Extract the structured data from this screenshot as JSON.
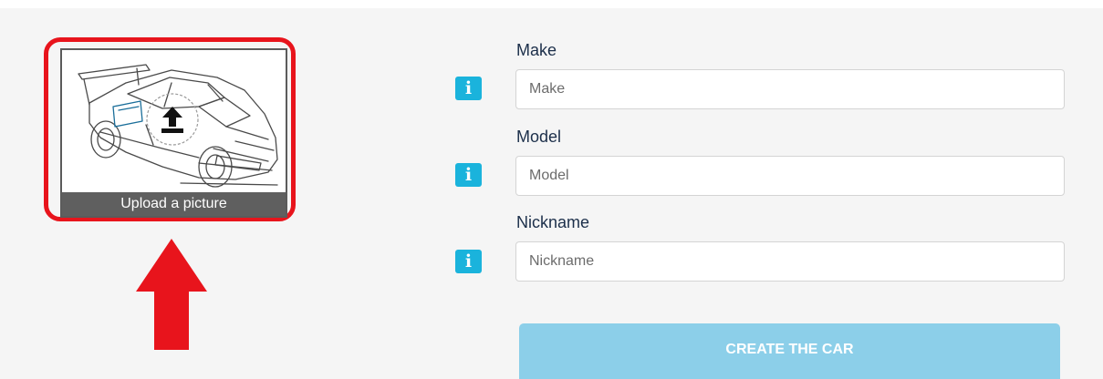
{
  "upload": {
    "label": "Upload a picture"
  },
  "fields": [
    {
      "label": "Make",
      "placeholder": "Make"
    },
    {
      "label": "Model",
      "placeholder": "Model"
    },
    {
      "label": "Nickname",
      "placeholder": "Nickname"
    }
  ],
  "actions": {
    "create_label": "CREATE THE CAR"
  },
  "colors": {
    "highlight": "#e8141c",
    "info_icon": "#1ab3dc",
    "button": "#8ccfe9",
    "label_text": "#1c2f4a"
  },
  "icons": {
    "info": "info-icon",
    "upload": "upload-icon",
    "arrow": "red-arrow-up-icon"
  }
}
